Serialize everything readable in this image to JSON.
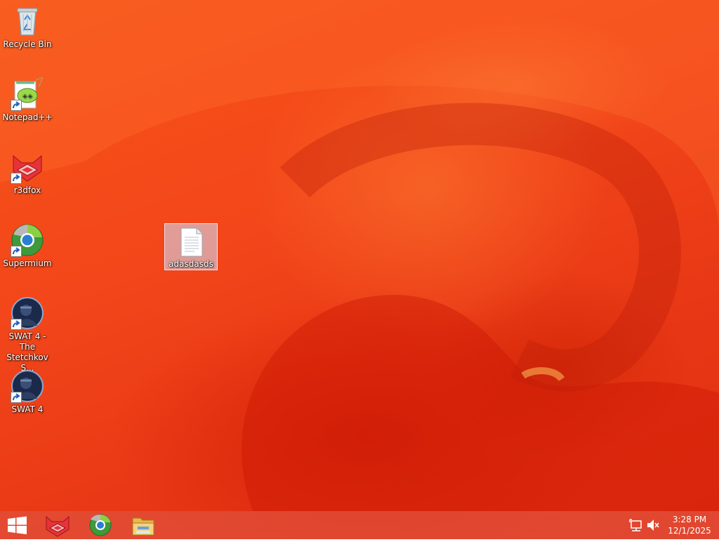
{
  "desktop": {
    "icons": [
      {
        "label": "Recycle Bin",
        "icon": "recycle-bin-icon"
      },
      {
        "label": "Notepad++",
        "icon": "notepad-plus-plus-icon"
      },
      {
        "label": "r3dfox",
        "icon": "r3dfox-icon"
      },
      {
        "label": "Supermium",
        "icon": "supermium-icon"
      },
      {
        "label": "SWAT 4 - The Stetchkov S...",
        "icon": "swat4-icon"
      },
      {
        "label": "SWAT 4",
        "icon": "swat4-icon"
      }
    ],
    "file": {
      "label": "adasdasds",
      "icon": "text-file-icon",
      "selected": true
    }
  },
  "taskbar": {
    "pinned": [
      {
        "name": "r3dfox",
        "icon": "r3dfox-icon"
      },
      {
        "name": "Supermium",
        "icon": "supermium-icon"
      },
      {
        "name": "File Explorer",
        "icon": "folder-icon"
      }
    ],
    "tray": {
      "network_icon": "network-icon",
      "volume_icon": "volume-muted-icon"
    },
    "clock": {
      "time": "3:28 PM",
      "date": "12/1/2025"
    }
  },
  "colors": {
    "wallpaper": "#f3461a",
    "taskbar": "#e1503c",
    "selection": "#d2e1ff"
  }
}
